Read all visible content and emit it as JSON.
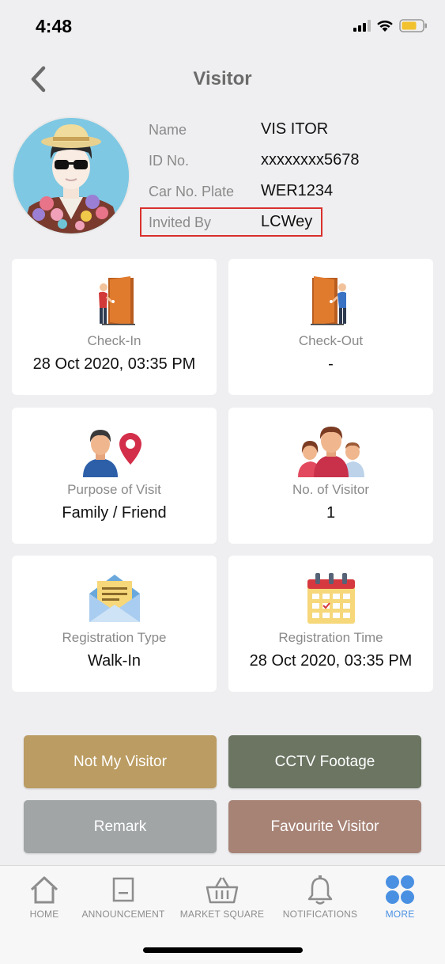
{
  "status_bar": {
    "time": "4:48"
  },
  "header": {
    "title": "Visitor"
  },
  "visitor": {
    "fields": [
      {
        "label": "Name",
        "value": "VIS ITOR"
      },
      {
        "label": "ID No.",
        "value": "xxxxxxxx5678"
      },
      {
        "label": "Car No. Plate",
        "value": "WER1234"
      },
      {
        "label": "Invited By",
        "value": "LCWey"
      }
    ]
  },
  "cards": [
    {
      "label": "Check-In",
      "value": "28 Oct 2020, 03:35 PM",
      "icon": "door-enter-icon"
    },
    {
      "label": "Check-Out",
      "value": "-",
      "icon": "door-exit-icon"
    },
    {
      "label": "Purpose of Visit",
      "value": "Family / Friend",
      "icon": "person-location-icon"
    },
    {
      "label": "No. of Visitor",
      "value": "1",
      "icon": "group-icon"
    },
    {
      "label": "Registration Type",
      "value": "Walk-In",
      "icon": "envelope-icon"
    },
    {
      "label": "Registration Time",
      "value": "28 Oct 2020, 03:35 PM",
      "icon": "calendar-icon"
    }
  ],
  "actions": {
    "not_my_visitor": "Not My Visitor",
    "cctv_footage": "CCTV Footage",
    "remark": "Remark",
    "favourite_visitor": "Favourite Visitor"
  },
  "colors": {
    "not_my_visitor": "#bb9c62",
    "cctv_footage": "#6b7562",
    "remark": "#a1a5a6",
    "favourite_visitor": "#a78376",
    "active_tab": "#4a90e2",
    "highlight": "#d9302c"
  },
  "tabs": [
    {
      "label": "HOME",
      "icon": "home-icon"
    },
    {
      "label": "ANNOUNCEMENT",
      "icon": "announcement-icon"
    },
    {
      "label": "MARKET SQUARE",
      "icon": "basket-icon"
    },
    {
      "label": "NOTIFICATIONS",
      "icon": "bell-icon"
    },
    {
      "label": "MORE",
      "icon": "more-dots-icon",
      "active": true
    }
  ]
}
